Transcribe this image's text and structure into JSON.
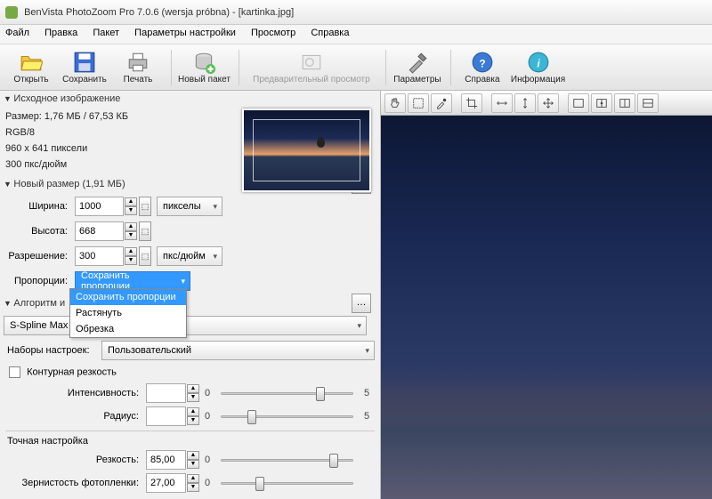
{
  "window": {
    "title": "BenVista PhotoZoom Pro 7.0.6 (wersja próbna) - [kartinka.jpg]"
  },
  "menu": [
    "Файл",
    "Правка",
    "Пакет",
    "Параметры настройки",
    "Просмотр",
    "Справка"
  ],
  "toolbar": {
    "open": "Открыть",
    "save": "Сохранить",
    "print": "Печать",
    "newbatch": "Новый пакет",
    "preview": "Предварительный просмотр",
    "params": "Параметры",
    "help": "Справка",
    "info": "Информация"
  },
  "source": {
    "header": "Исходное изображение",
    "size": "Размер: 1,76 МБ / 67,53 КБ",
    "mode": "RGB/8",
    "dims": "960 x 641 пиксели",
    "dpi": "300 пкс/дюйм"
  },
  "newsize": {
    "header": "Новый размер (1,91 МБ)",
    "width_lbl": "Ширина:",
    "width": "1000",
    "height_lbl": "Высота:",
    "height": "668",
    "unit_px": "пикселы",
    "res_lbl": "Разрешение:",
    "res": "300",
    "unit_dpi": "пкс/дюйм",
    "prop_lbl": "Пропорции:",
    "prop_value": "Сохранить пропорции",
    "prop_options": [
      "Сохранить пропорции",
      "Растянуть",
      "Обрезка"
    ]
  },
  "algo": {
    "header": "Алгоритм и",
    "value": "S-Spline Max",
    "presets_lbl": "Наборы настроек:",
    "presets_value": "Пользовательский",
    "contour_lbl": "Контурная резкость",
    "intensity_lbl": "Интенсивность:",
    "radius_lbl": "Радиус:",
    "fine_header": "Точная настройка",
    "sharp_lbl": "Резкость:",
    "sharp": "85,00",
    "grain_lbl": "Зернистость фотопленки:",
    "grain": "27,00",
    "scale_min": "0",
    "scale_mid": "5"
  }
}
